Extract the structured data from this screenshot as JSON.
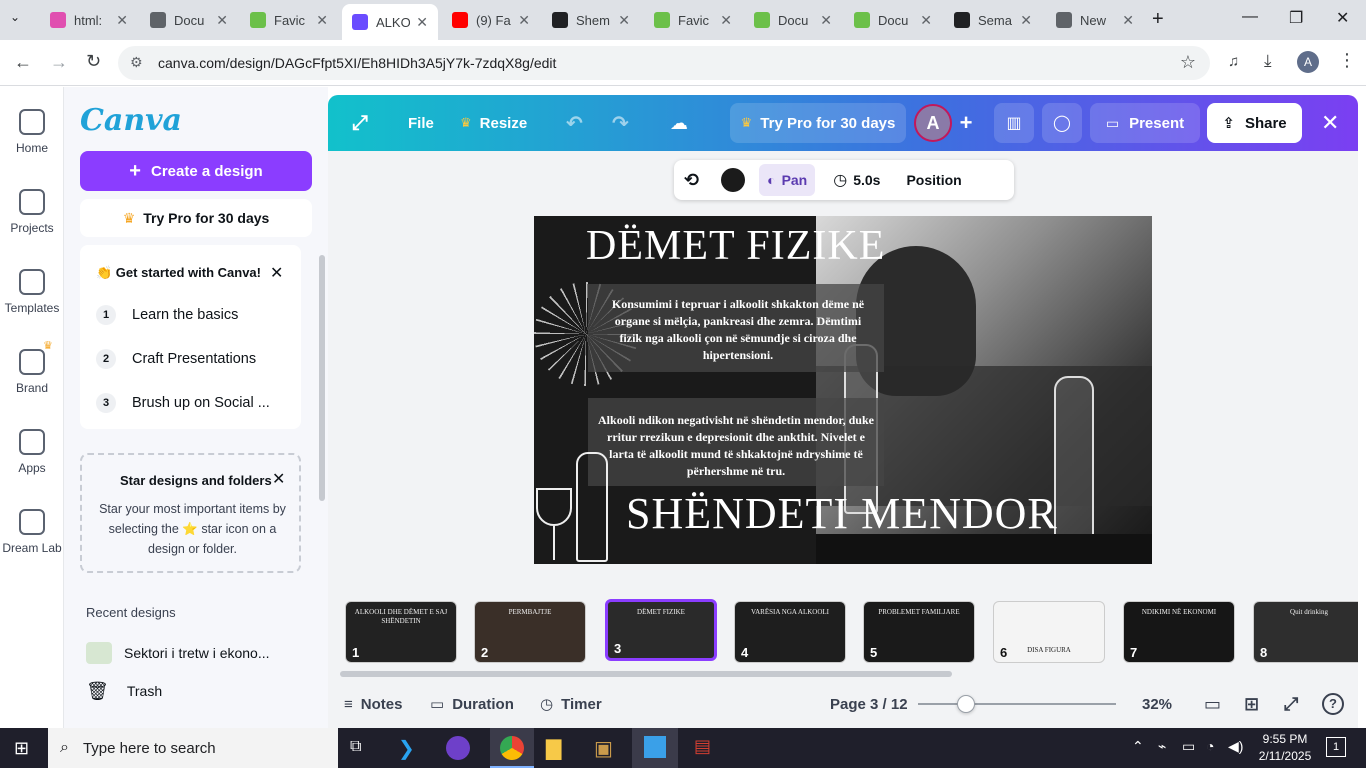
{
  "browser": {
    "tabs": [
      {
        "title": "html:",
        "fav_color": "#e04fb0",
        "fav_icon": "flask-icon"
      },
      {
        "title": "Docu",
        "fav_color": "#5f6368",
        "fav_icon": "globe-icon"
      },
      {
        "title": "Favic",
        "fav_color": "#6cc04a",
        "fav_icon": "am-logo-icon"
      },
      {
        "title": "ALKO",
        "fav_color": "#6a4cff",
        "fav_icon": "canva-icon",
        "active": true
      },
      {
        "title": "(9) Fa",
        "fav_color": "#ff0000",
        "fav_icon": "youtube-icon"
      },
      {
        "title": "Shem",
        "fav_color": "#202124",
        "fav_icon": "openai-icon"
      },
      {
        "title": "Favic",
        "fav_color": "#6cc04a",
        "fav_icon": "am-logo-icon"
      },
      {
        "title": "Docu",
        "fav_color": "#6cc04a",
        "fav_icon": "am-logo-icon"
      },
      {
        "title": "Docu",
        "fav_color": "#6cc04a",
        "fav_icon": "am-logo-icon"
      },
      {
        "title": "Sema",
        "fav_color": "#202124",
        "fav_icon": "openai-icon"
      },
      {
        "title": "New",
        "fav_color": "#5f6368",
        "fav_icon": "chrome-icon"
      }
    ],
    "url": "canva.com/design/DAGcFfpt5XI/Eh8HIDh3A5jY7k-7zdqX8g/edit",
    "profile_initial": "A"
  },
  "rail": {
    "items": [
      {
        "label": "Home",
        "icon": "home-icon"
      },
      {
        "label": "Projects",
        "icon": "folder-icon"
      },
      {
        "label": "Templates",
        "icon": "templates-icon"
      },
      {
        "label": "Brand",
        "icon": "brand-icon"
      },
      {
        "label": "Apps",
        "icon": "apps-icon"
      },
      {
        "label": "Dream Lab",
        "icon": "dream-lab-icon"
      }
    ]
  },
  "panel": {
    "logo": "Canva",
    "create_label": "Create a design",
    "pro_label": "Try Pro for 30 days",
    "get_started": {
      "title": "👏 Get started with Canva!",
      "steps": [
        {
          "num": "1",
          "label": "Learn the basics"
        },
        {
          "num": "2",
          "label": "Craft Presentations"
        },
        {
          "num": "3",
          "label": "Brush up on Social ..."
        }
      ]
    },
    "star_card": {
      "title": "Star designs and folders",
      "body": "Star your most important items by selecting the ⭐ star icon on a design or folder."
    },
    "recent_title": "Recent designs",
    "recent_item": "Sektori i tretw i ekono...",
    "trash_label": "Trash"
  },
  "topbar": {
    "file": "File",
    "resize": "Resize",
    "try_pro": "Try Pro for 30 days",
    "avatar": "A",
    "present": "Present",
    "share": "Share"
  },
  "context": {
    "pan": "Pan",
    "duration": "5.0s",
    "position": "Position"
  },
  "slide": {
    "title1": "DËMET FIZIKE",
    "text1": "Konsumimi i tepruar i alkoolit shkakton dëme në organe si mëlçia, pankreasi dhe zemra. Dëmtimi fizik nga alkooli çon në sëmundje si ciroza dhe hipertensioni.",
    "text2": "Alkooli ndikon negativisht në shëndetin mendor, duke rritur rrezikun e depresionit dhe ankthit. Nivelet e larta të alkoolit mund të shkaktojnë ndryshime të përhershme në tru.",
    "title2": "SHËNDETI MENDOR"
  },
  "thumbnails": [
    {
      "num": "1",
      "text": "ALKOOLI DHE DËMET E SAJ SHËNDETIN"
    },
    {
      "num": "2",
      "text": "PERMBAJTJE"
    },
    {
      "num": "3",
      "text": "DËMET FIZIKE"
    },
    {
      "num": "4",
      "text": "VARËSIA NGA ALKOOLI"
    },
    {
      "num": "5",
      "text": "PROBLEMET FAMILJARE"
    },
    {
      "num": "6",
      "text": "DISA FIGURA"
    },
    {
      "num": "7",
      "text": "NDIKIMI NË EKONOMI"
    },
    {
      "num": "8",
      "text": "Quit drinking"
    }
  ],
  "bottom": {
    "notes": "Notes",
    "duration": "Duration",
    "timer": "Timer",
    "page": "Page 3 / 12",
    "zoom": "32%",
    "zoom_level": 0.32
  },
  "taskbar": {
    "search_placeholder": "Type here to search",
    "time": "9:55 PM",
    "date": "2/11/2025",
    "notif_count": "1"
  }
}
